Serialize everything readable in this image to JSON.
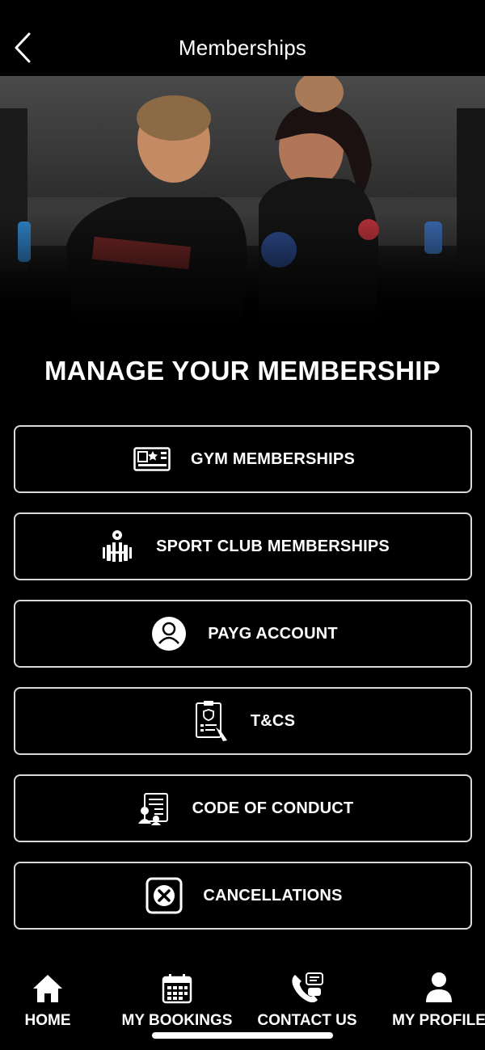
{
  "header": {
    "title": "Memberships",
    "back_icon": "chevron-left-icon"
  },
  "hero": {
    "description": ""
  },
  "main": {
    "heading": "MANAGE YOUR MEMBERSHIP",
    "items": [
      {
        "label": "GYM MEMBERSHIPS",
        "icon": "membership-card-icon"
      },
      {
        "label": "SPORT CLUB MEMBERSHIPS",
        "icon": "weightlifter-icon"
      },
      {
        "label": "PAYG ACCOUNT",
        "icon": "user-circle-icon"
      },
      {
        "label": "T&CS",
        "icon": "clipboard-document-icon"
      },
      {
        "label": "CODE OF CONDUCT",
        "icon": "conduct-document-icon"
      },
      {
        "label": "CANCELLATIONS",
        "icon": "cancel-x-icon"
      }
    ]
  },
  "tabbar": {
    "tabs": [
      {
        "label": "HOME",
        "icon": "home-icon"
      },
      {
        "label": "MY BOOKINGS",
        "icon": "calendar-icon"
      },
      {
        "label": "CONTACT US",
        "icon": "phone-chat-icon"
      },
      {
        "label": "MY PROFILE",
        "icon": "profile-icon"
      }
    ]
  },
  "colors": {
    "background": "#000000",
    "text": "#ffffff",
    "border": "#d9d9d9"
  }
}
